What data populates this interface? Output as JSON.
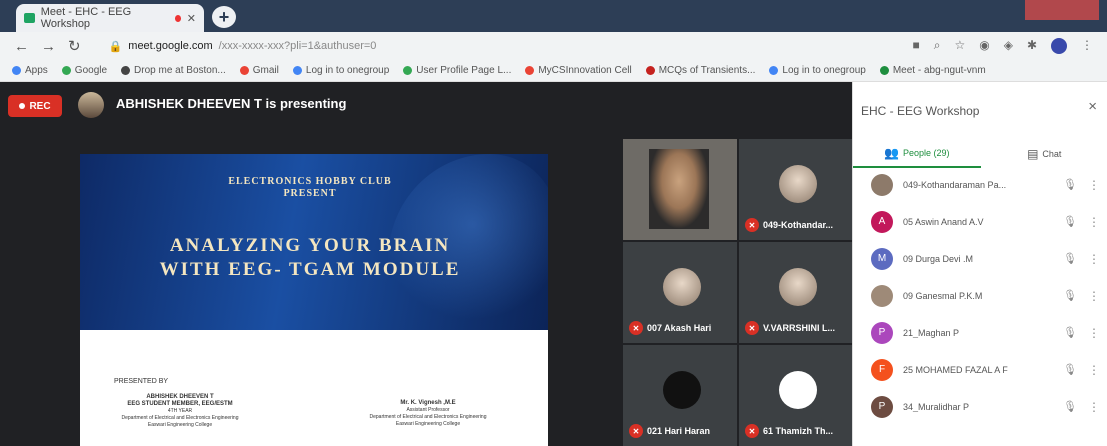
{
  "browser": {
    "tab_title": "Meet - EHC - EEG Workshop",
    "new_tab": "+",
    "address_host": "meet.google.com",
    "address_path": "/xxx-xxxx-xxx?pli=1&authuser=0",
    "bookmarks": [
      {
        "label": "Apps",
        "color": "#4285f4"
      },
      {
        "label": "Google",
        "color": "#34a853"
      },
      {
        "label": "Drop me at Boston...",
        "color": "#444"
      },
      {
        "label": "Gmail",
        "color": "#ea4335"
      },
      {
        "label": "Log in to onegroup",
        "color": "#4285f4"
      },
      {
        "label": "User Profile Page L...",
        "color": "#34a853"
      },
      {
        "label": "MyCSInnovation Cell",
        "color": "#ea4335"
      },
      {
        "label": "MCQs of Transients...",
        "color": "#c5221f"
      },
      {
        "label": "Log in to onegroup",
        "color": "#4285f4"
      },
      {
        "label": "Meet - abg-ngut-vnm",
        "color": "#1e8e3e"
      }
    ]
  },
  "meet": {
    "rec_label": "REC",
    "presenting_text": "ABHISHEK DHEEVEN T is presenting",
    "slide": {
      "club_line1": "ELECTRONICS HOBBY CLUB",
      "club_line2": "PRESENT",
      "title_line1": "ANALYZING YOUR BRAIN",
      "title_line2": "WITH EEG- TGAM MODULE",
      "presented_by": "PRESENTED BY",
      "presenter1_name": "ABHISHEK DHEEVEN T",
      "presenter1_role": "EEG STUDENT MEMBER, EEG/ESTM",
      "presenter1_year": "4TH YEAR",
      "presenter1_dept": "Department of Electrical and Electronics Engineering",
      "presenter1_college": "Easwari Engineering College",
      "presenter2_name": "Mr. K. Vignesh ,M.E",
      "presenter2_role": "Assistant Professor",
      "presenter2_dept": "Department of Electrical and Electronics Engineering",
      "presenter2_college": "Easwari Engineering College"
    },
    "tiles": [
      {
        "label": ""
      },
      {
        "label": "049-Kothandar..."
      },
      {
        "label": "007 Akash Hari"
      },
      {
        "label": "V.VARRSHINI L..."
      },
      {
        "label": "021 Hari Haran"
      },
      {
        "label": "61 Thamizh Th..."
      }
    ]
  },
  "panel": {
    "title": "EHC - EEG Workshop",
    "close": "×",
    "people_tab": "People (29)",
    "chat_tab": "Chat",
    "participants": [
      {
        "initial": "",
        "name": "049-Kothandaraman Pa...",
        "color": "#8d7a6a"
      },
      {
        "initial": "A",
        "name": "05 Aswin Anand A.V",
        "color": "#c2185b"
      },
      {
        "initial": "M",
        "name": "09 Durga Devi .M",
        "color": "#5c6bc0"
      },
      {
        "initial": "",
        "name": "09 Ganesmal P.K.M",
        "color": "#9e8a78"
      },
      {
        "initial": "P",
        "name": "21_Maghan P",
        "color": "#ab47bc"
      },
      {
        "initial": "F",
        "name": "25 MOHAMED FAZAL A F",
        "color": "#f4511e"
      },
      {
        "initial": "P",
        "name": "34_Muralidhar P",
        "color": "#6d4c41"
      }
    ]
  }
}
